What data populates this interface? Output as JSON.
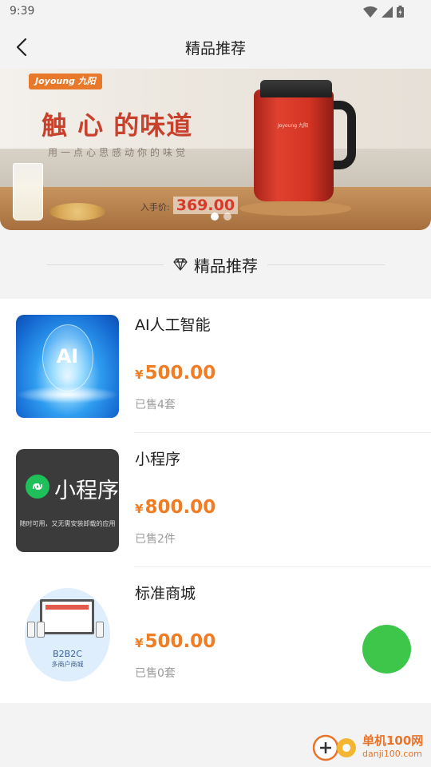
{
  "status_bar": {
    "time": "9:39"
  },
  "nav": {
    "title": "精品推荐"
  },
  "banner": {
    "brand": "Joyoung 九阳",
    "slogan": "触 心 的味道",
    "subtitle": "用一点心思感动你的味觉",
    "price_label": "入手价:",
    "price_value": "369.00",
    "kettle_brand": "Joyoung 九阳",
    "dots_count": 2,
    "active_dot": 0
  },
  "section": {
    "title": "精品推荐",
    "icon": "diamond-icon"
  },
  "products": [
    {
      "name": "AI人工智能",
      "currency": "¥",
      "price": "500.00",
      "sold": "已售4套",
      "thumb_text": "AI"
    },
    {
      "name": "小程序",
      "currency": "¥",
      "price": "800.00",
      "sold": "已售2件",
      "thumb_title": "小程序",
      "thumb_sub": "随时可用，又无需安装卸载的应用"
    },
    {
      "name": "标准商城",
      "currency": "¥",
      "price": "500.00",
      "sold": "已售0套",
      "thumb_code": "B2B2C",
      "thumb_sub": "多商户商城"
    }
  ],
  "fab": {
    "color": "#3ec64b"
  },
  "watermark": {
    "name": "单机100网",
    "url": "danji100.com"
  },
  "colors": {
    "accent": "#f07d24",
    "background": "#f3f3f3"
  }
}
